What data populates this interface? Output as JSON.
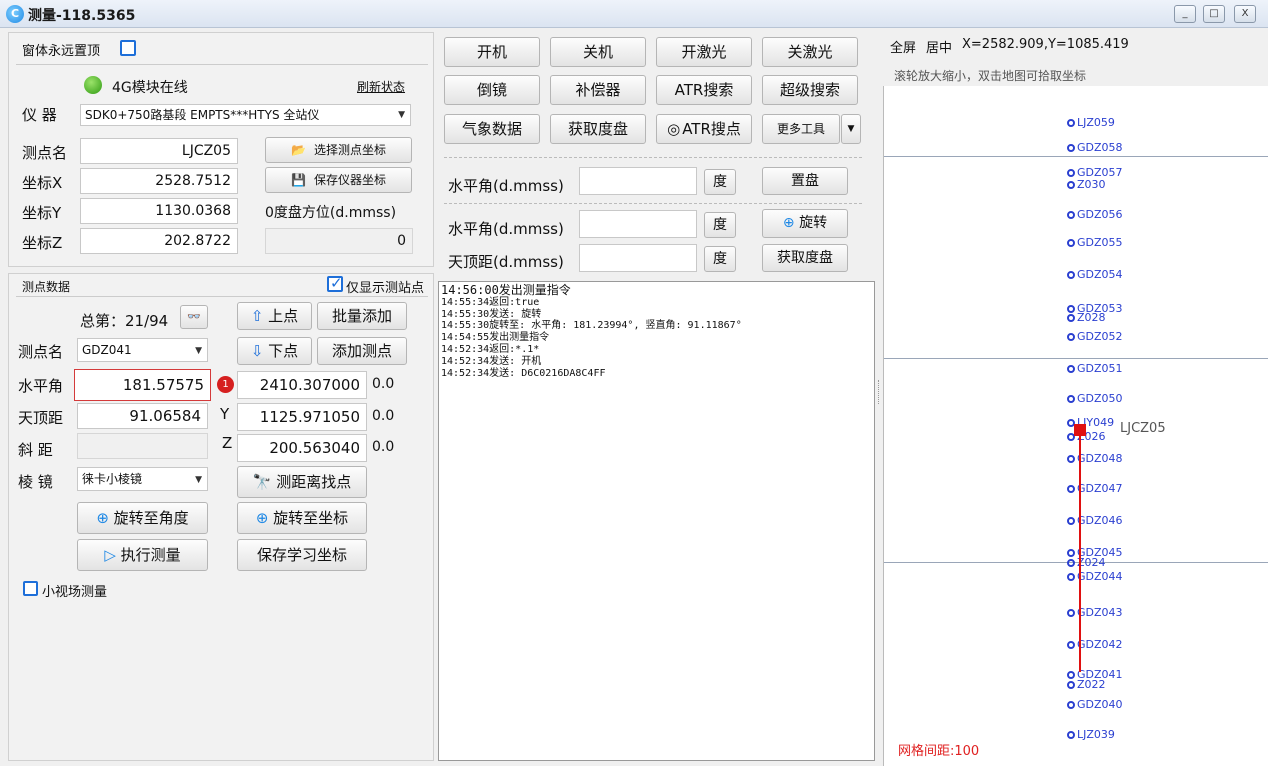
{
  "window": {
    "title": "测量-118.5365",
    "icon_letter": "C",
    "min": "_",
    "max": "□",
    "close": "X"
  },
  "top_options": {
    "always_on_top_label": "窗体永远置顶"
  },
  "status": {
    "module_text": "4G模块在线",
    "refresh_label": "刷新状态"
  },
  "instrument": {
    "label": "仪 器",
    "value": "SDK0+750路基段 EMPTS***HTYS 全站仪"
  },
  "station": {
    "name_label": "测点名",
    "name_value": "LJCZ05",
    "select_btn": "选择测点坐标",
    "x_label": "坐标X",
    "x_value": "2528.7512",
    "save_btn": "保存仪器坐标",
    "y_label": "坐标Y",
    "y_value": "1130.0368",
    "zero_label": "0度盘方位(d.mmss)",
    "z_label": "坐标Z",
    "z_value": "202.8722",
    "zero_value": "0"
  },
  "points": {
    "section_label": "测点数据",
    "only_station_label": "仅显示测站点",
    "total_text": "总第：21/94",
    "prev_btn": "上点",
    "next_btn": "下点",
    "batch_btn": "批量添加",
    "add_btn": "添加测点",
    "name_label": "测点名",
    "name_value": "GDZ041",
    "hz_label": "水平角",
    "hz_value": "181.57575",
    "badge": "1",
    "x_value": "2410.307000",
    "x_delta": "0.0",
    "v_label": "天顶距",
    "v_value": "91.06584",
    "y_axis": "Y",
    "y_value": "1125.971050",
    "y_delta": "0.0",
    "sd_label": "斜 距",
    "sd_value": "",
    "z_axis": "Z",
    "z_value": "200.563040",
    "z_delta": "0.0",
    "prism_label": "棱 镜",
    "prism_value": "徕卡小棱镜",
    "find_btn": "测距离找点",
    "rot_angle_btn": "旋转至角度",
    "rot_coord_btn": "旋转至坐标",
    "measure_btn": "执行测量",
    "save_learn_btn": "保存学习坐标",
    "small_field_label": "小视场测量"
  },
  "cmd_buttons": [
    [
      "开机",
      "关机",
      "开激光",
      "关激光"
    ],
    [
      "倒镜",
      "补偿器",
      "ATR搜索",
      "超级搜索"
    ],
    [
      "气象数据",
      "获取度盘",
      "ATR搜点",
      "更多工具"
    ]
  ],
  "angles": {
    "hz_label": "水平角(d.mmss)",
    "deg": "度",
    "set_plate_btn": "置盘",
    "hz2_label": "水平角(d.mmss)",
    "rotate_btn": "旋转",
    "zen_label": "天顶距(d.mmss)",
    "get_plate_btn": "获取度盘"
  },
  "log_lines": [
    "14:56:00发出测量指令",
    "14:55:34返回:true",
    "14:55:30发送: 旋转",
    "14:55:30旋转至: 水平角: 181.23994°, 竖直角: 91.11867°",
    "14:54:55发出测量指令",
    "14:52:34返回:*.1*",
    "14:52:34发送: 开机",
    "14:52:34发送: D6C0216DA8C4FF"
  ],
  "map": {
    "fullscreen": "全屏",
    "center": "居中",
    "coord_readout": "X=2582.909,Y=1085.419",
    "hint": "滚轮放大缩小，双击地图可拾取坐标",
    "grid_spacing": "网格间距:100",
    "station_label": "LJCZ05",
    "point_labels": [
      "LJZ059",
      "GDZ058",
      "GDZ057",
      "Z030",
      "GDZ056",
      "GDZ055",
      "GDZ054",
      "GDZ053",
      "Z028",
      "GDZ052",
      "GDZ051",
      "GDZ050",
      "LJY049",
      "Z026",
      "GDZ048",
      "GDZ047",
      "GDZ046",
      "GDZ045",
      "Z024",
      "GDZ044",
      "GDZ043",
      "GDZ042",
      "GDZ041",
      "Z022",
      "GDZ040",
      "LJZ039"
    ]
  }
}
